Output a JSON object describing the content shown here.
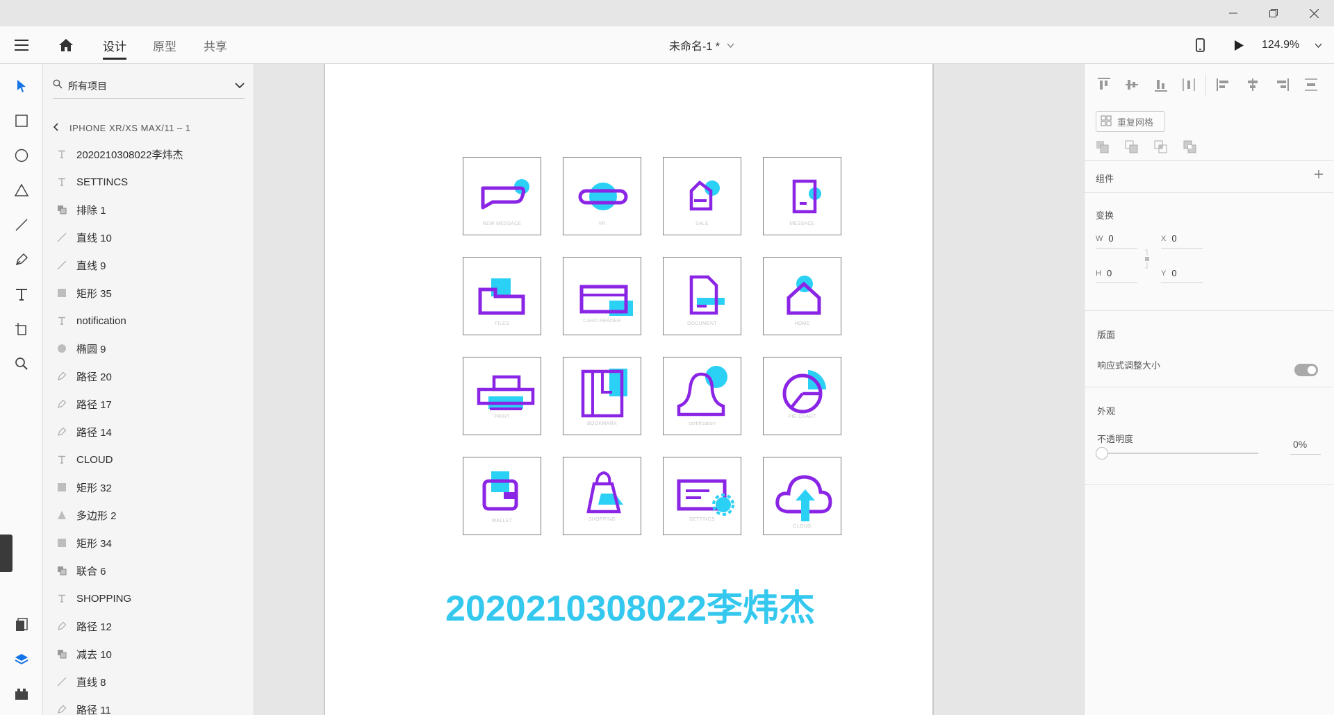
{
  "app": {
    "tabs": [
      {
        "label": "设计",
        "active": true
      },
      {
        "label": "原型",
        "active": false
      },
      {
        "label": "共享",
        "active": false
      }
    ],
    "doc_title": "未命名-1 *",
    "zoom": "124.9%"
  },
  "layers_panel": {
    "search_label": "所有项目",
    "breadcrumb": "IPHONE XR/XS MAX/11 – 1",
    "items": [
      {
        "icon": "text-icon",
        "label": "2020210308022李炜杰"
      },
      {
        "icon": "text-icon",
        "label": "SETTINCS"
      },
      {
        "icon": "group-icon",
        "label": "排除 1"
      },
      {
        "icon": "line-icon",
        "label": "直线 10"
      },
      {
        "icon": "line-icon",
        "label": "直线 9"
      },
      {
        "icon": "rect-icon",
        "label": "矩形 35"
      },
      {
        "icon": "text-icon",
        "label": "notification"
      },
      {
        "icon": "ellipse-icon",
        "label": "椭圆 9"
      },
      {
        "icon": "pen-icon",
        "label": "路径 20"
      },
      {
        "icon": "pen-icon",
        "label": "路径 17"
      },
      {
        "icon": "pen-icon",
        "label": "路径 14"
      },
      {
        "icon": "text-icon",
        "label": "CLOUD"
      },
      {
        "icon": "rect-icon",
        "label": "矩形 32"
      },
      {
        "icon": "polygon-icon",
        "label": "多边形 2"
      },
      {
        "icon": "rect-icon",
        "label": "矩形 34"
      },
      {
        "icon": "group-icon",
        "label": "联合 6"
      },
      {
        "icon": "text-icon",
        "label": "SHOPPING"
      },
      {
        "icon": "pen-icon",
        "label": "路径 12"
      },
      {
        "icon": "group-icon",
        "label": "减去 10"
      },
      {
        "icon": "line-icon",
        "label": "直线 8"
      },
      {
        "icon": "pen-icon",
        "label": "路径 11"
      }
    ]
  },
  "artboard": {
    "icons": [
      {
        "caption": "NEW MESSACE"
      },
      {
        "caption": "VR"
      },
      {
        "caption": "SALE"
      },
      {
        "caption": "MESSACE"
      },
      {
        "caption": "FILES"
      },
      {
        "caption": "CARD READER"
      },
      {
        "caption": "DOCUMENT"
      },
      {
        "caption": "HOME"
      },
      {
        "caption": "PRINT"
      },
      {
        "caption": "BOOKMARK"
      },
      {
        "caption": "certification"
      },
      {
        "caption": "PIE CHART"
      },
      {
        "caption": "WALLET"
      },
      {
        "caption": "SHOPPING"
      },
      {
        "caption": "SETTINCS"
      },
      {
        "caption": "CLOUD"
      }
    ],
    "heading": "2020210308022李炜杰",
    "colors": {
      "purple": "#8a25e6",
      "cyan": "#2bd0f5",
      "heading": "#35c8ee"
    }
  },
  "props": {
    "repeat_grid": "重复网格",
    "component_label": "组件",
    "transform_label": "变换",
    "w": {
      "key": "W",
      "value": "0"
    },
    "h": {
      "key": "H",
      "value": "0"
    },
    "x": {
      "key": "X",
      "value": "0"
    },
    "y": {
      "key": "Y",
      "value": "0"
    },
    "layout_label": "版面",
    "responsive_label": "响应式调整大小",
    "appearance_label": "外观",
    "opacity_label": "不透明度",
    "opacity_value": "0%"
  }
}
